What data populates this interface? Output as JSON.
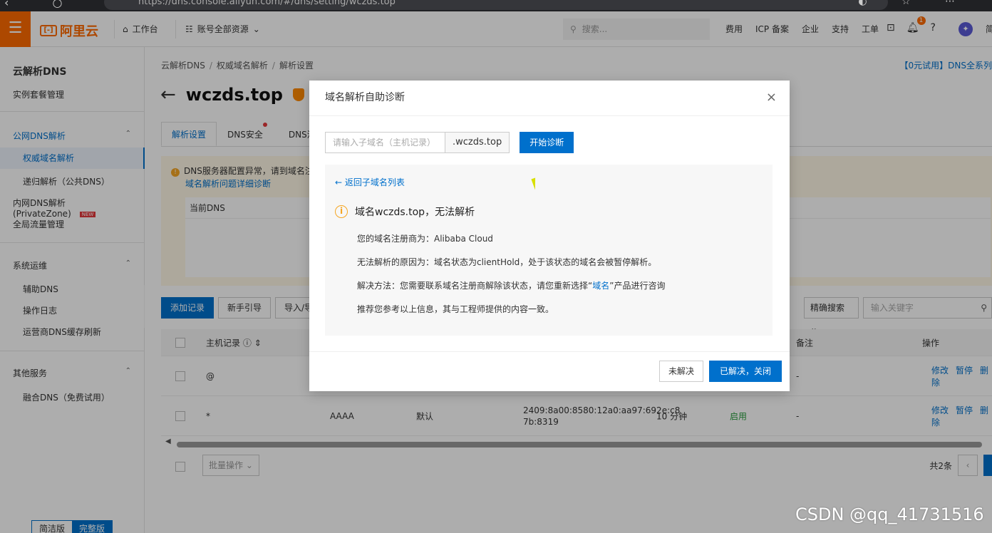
{
  "browser": {
    "url": "https://dns.console.aliyun.com/#/dns/setting/wczds.top"
  },
  "topnav": {
    "logo_text": "阿里云",
    "workbench": "工作台",
    "resources": "账号全部资源",
    "search_placeholder": "搜索...",
    "menu": [
      "费用",
      "ICP 备案",
      "企业",
      "支持",
      "工单"
    ],
    "notif_count": "1",
    "more": "简"
  },
  "sidebar": {
    "title": "云解析DNS",
    "instance": "实例套餐管理",
    "public_group": "公网DNS解析",
    "authoritative": "权威域名解析",
    "recursive": "递归解析（公共DNS）",
    "private_zone": "内网DNS解析 (PrivateZone)",
    "new_tag": "NEW",
    "global_traffic": "全局流量管理",
    "ops_group": "系统运维",
    "aux_dns": "辅助DNS",
    "op_log": "操作日志",
    "isp_refresh": "运营商DNS缓存刷新",
    "other_group": "其他服务",
    "fusion_dns": "融合DNS（免费试用）",
    "simple_version": "简洁版",
    "full_version": "完整版"
  },
  "main": {
    "breadcrumb": [
      "云解析DNS",
      "权威域名解析",
      "解析设置"
    ],
    "promo": "【0元试用】DNS全系列",
    "title": "wczds.top",
    "tabs": [
      "解析设置",
      "DNS安全",
      "DNS流"
    ],
    "warning": "DNS服务器配置异常，请到域名注册",
    "warning_link": "域名解析问题详细诊断",
    "current_dns": "当前DNS",
    "buttons": {
      "add": "添加记录",
      "guide": "新手引导",
      "import": "导入/导"
    },
    "precise_search": "精确搜索",
    "keyword_placeholder": "输入关键字",
    "columns": {
      "host": "主机记录",
      "remark": "备注",
      "action": "操作"
    },
    "rows": [
      {
        "host": "@",
        "type": "",
        "line": "",
        "value": "",
        "ttl": "",
        "status": "",
        "remark": "-"
      },
      {
        "host": "*",
        "type": "AAAA",
        "line": "默认",
        "value": "2409:8a00:8580:12a0:aa97:692e:c8",
        "value2": "7b:8319",
        "ttl": "10 分钟",
        "status": "启用",
        "remark": "-"
      }
    ],
    "ops": [
      "修改",
      "暂停",
      "删除"
    ],
    "batch": "批量操作",
    "total": "共2条"
  },
  "modal": {
    "title": "域名解析自助诊断",
    "sub_placeholder": "请输入子域名（主机记录）",
    "suffix": ".wczds.top",
    "start": "开始诊断",
    "back": "返回子域名列表",
    "result_title": "域名wczds.top，无法解析",
    "registrar": "您的域名注册商为：Alibaba Cloud",
    "reason": "无法解析的原因为：域名状态为clientHold，处于该状态的域名会被暂停解析。",
    "solution_pre": "解决方法：您需要联系域名注册商解除该状态，请您重新选择“",
    "solution_link": "域名",
    "solution_post": "”产品进行咨询",
    "note": "推荐您参考以上信息，其与工程师提供的内容一致。",
    "unsolved": "未解决",
    "solved": "已解决，关闭"
  },
  "watermark": "CSDN @qq_41731516",
  "colors": {
    "brand": "#ff6a00",
    "primary": "#0070cc",
    "warning": "#f5a623"
  }
}
